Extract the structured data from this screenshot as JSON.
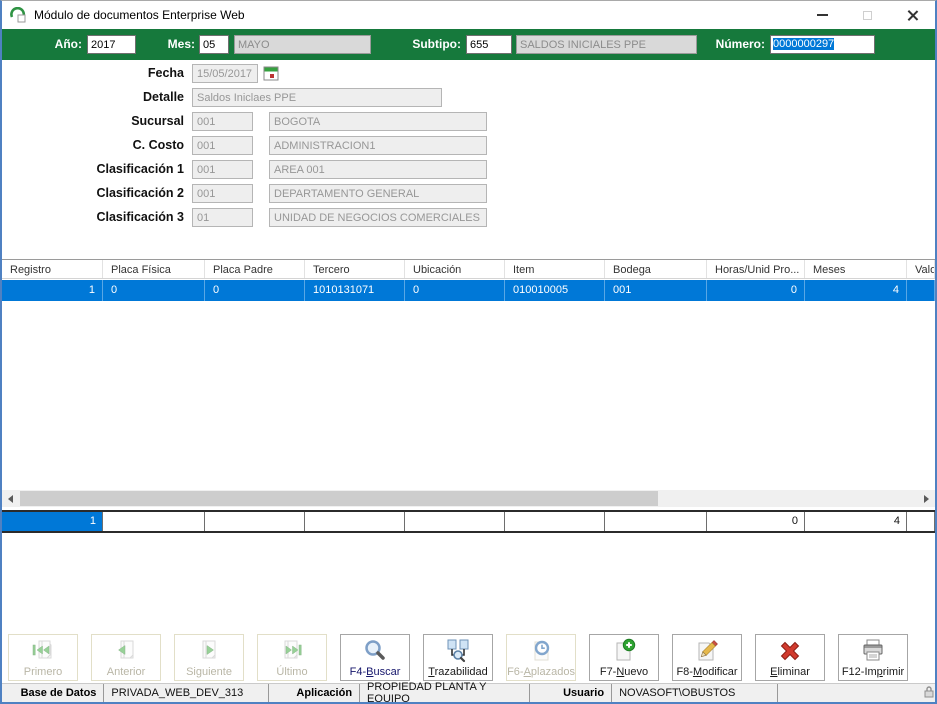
{
  "window": {
    "title": "Módulo de documentos Enterprise Web"
  },
  "header": {
    "ano_label": "Año:",
    "ano_value": "2017",
    "mes_label": "Mes:",
    "mes_value": "05",
    "mes_name": "MAYO",
    "subtipo_label": "Subtipo:",
    "subtipo_value": "655",
    "subtipo_name": "SALDOS INICIALES PPE",
    "numero_label": "Número:",
    "numero_value": "0000000297"
  },
  "form": {
    "fecha_label": "Fecha",
    "fecha_value": "15/05/2017",
    "detalle_label": "Detalle",
    "detalle_value": "Saldos Iniclaes PPE",
    "rows": [
      {
        "label": "Sucursal",
        "code": "001",
        "desc": "BOGOTA"
      },
      {
        "label": "C. Costo",
        "code": "001",
        "desc": "ADMINISTRACION1"
      },
      {
        "label": "Clasificación 1",
        "code": "001",
        "desc": "AREA 001"
      },
      {
        "label": "Clasificación 2",
        "code": "001",
        "desc": "DEPARTAMENTO GENERAL"
      },
      {
        "label": "Clasificación 3",
        "code": "01",
        "desc": "UNIDAD DE NEGOCIOS COMERCIALES"
      }
    ]
  },
  "grid": {
    "columns": [
      "Registro",
      "Placa Física",
      "Placa Padre",
      "Tercero",
      "Ubicación",
      "Item",
      "Bodega",
      "Horas/Unid Pro...",
      "Meses",
      "Valo"
    ],
    "row": [
      "1",
      "0",
      "0",
      "1010131071",
      "0",
      "010010005",
      "001",
      "0",
      "4",
      ""
    ],
    "summary": [
      "1",
      "",
      "",
      "",
      "",
      "",
      "",
      "0",
      "4",
      ""
    ]
  },
  "toolbar": {
    "buttons": [
      {
        "pre": "Primero",
        "key": "",
        "post": ""
      },
      {
        "pre": "Anterior",
        "key": "",
        "post": ""
      },
      {
        "pre": "Siguiente",
        "key": "",
        "post": ""
      },
      {
        "pre": "Último",
        "key": "",
        "post": ""
      },
      {
        "pre": "F4-",
        "key": "B",
        "post": "uscar"
      },
      {
        "pre": "",
        "key": "T",
        "post": "razabilidad"
      },
      {
        "pre": "F6-",
        "key": "A",
        "post": "plazados"
      },
      {
        "pre": "F7-",
        "key": "N",
        "post": "uevo"
      },
      {
        "pre": "F8-",
        "key": "M",
        "post": "odificar"
      },
      {
        "pre": "",
        "key": "E",
        "post": "liminar"
      },
      {
        "pre": "F12-Im",
        "key": "p",
        "post": "rimir"
      }
    ]
  },
  "statusbar": {
    "db_label": "Base de Datos",
    "db_value": "PRIVADA_WEB_DEV_313",
    "app_label": "Aplicación",
    "app_value": "PROPIEDAD PLANTA Y EQUIPO",
    "user_label": "Usuario",
    "user_value": "NOVASOFT\\OBUSTOS"
  },
  "colors": {
    "accent_green": "#16793C",
    "selection_blue": "#0078D7"
  }
}
